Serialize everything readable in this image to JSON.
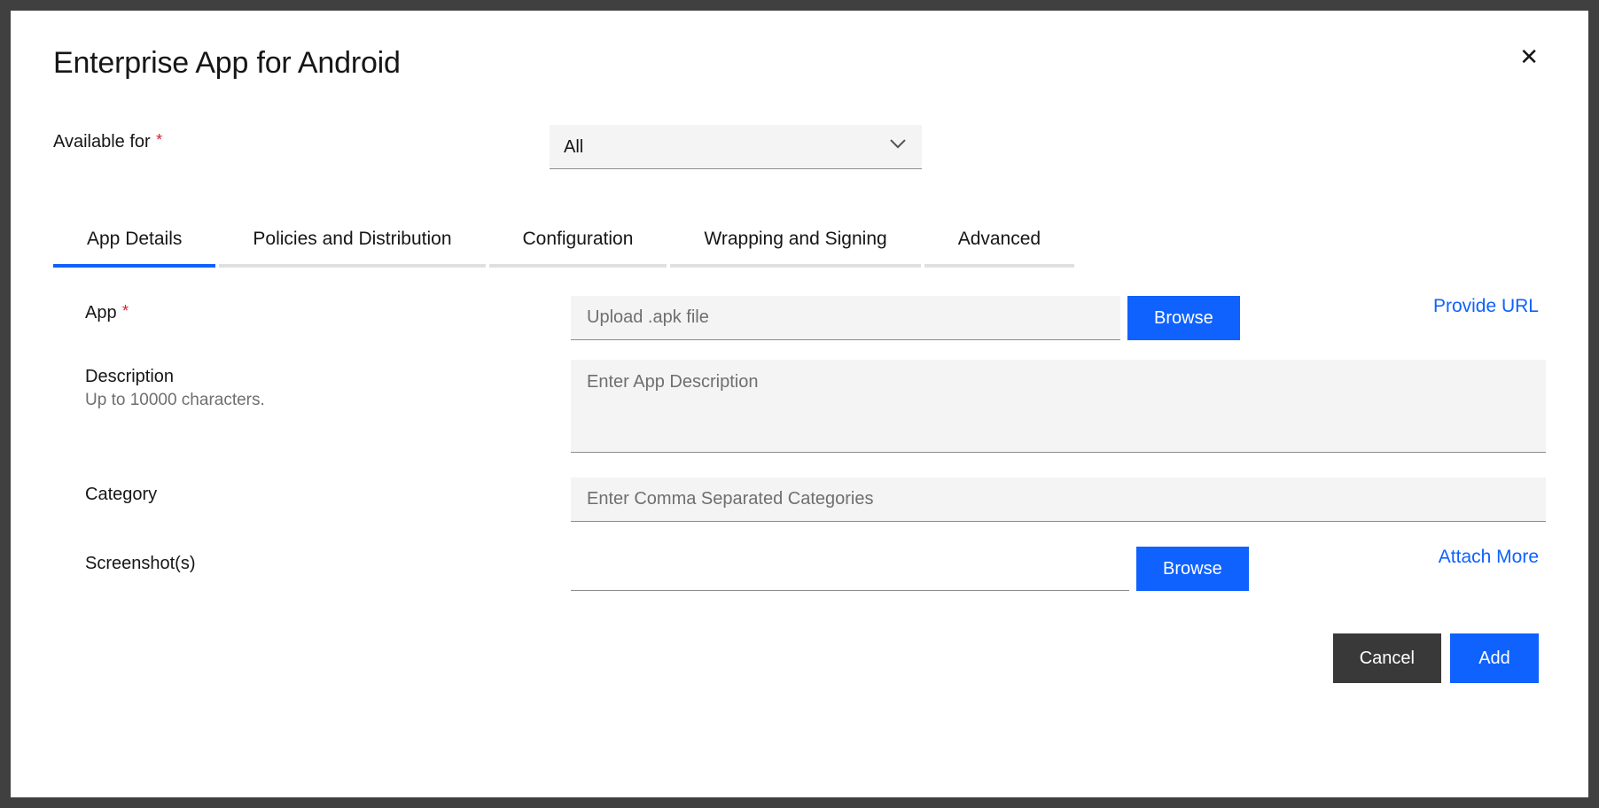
{
  "modal": {
    "title": "Enterprise App for Android",
    "close_label": "✕"
  },
  "availableFor": {
    "label": "Available for",
    "value": "All"
  },
  "tabs": [
    {
      "label": "App Details",
      "active": true
    },
    {
      "label": "Policies and Distribution",
      "active": false
    },
    {
      "label": "Configuration",
      "active": false
    },
    {
      "label": "Wrapping and Signing",
      "active": false
    },
    {
      "label": "Advanced",
      "active": false
    }
  ],
  "fields": {
    "app": {
      "label": "App",
      "placeholder": "Upload .apk file",
      "browse": "Browse",
      "provideUrl": "Provide URL"
    },
    "description": {
      "label": "Description",
      "hint": "Up to 10000 characters.",
      "placeholder": "Enter App Description"
    },
    "category": {
      "label": "Category",
      "placeholder": "Enter Comma Separated Categories"
    },
    "screenshots": {
      "label": "Screenshot(s)",
      "browse": "Browse",
      "attachMore": "Attach More"
    }
  },
  "footer": {
    "cancel": "Cancel",
    "add": "Add"
  }
}
